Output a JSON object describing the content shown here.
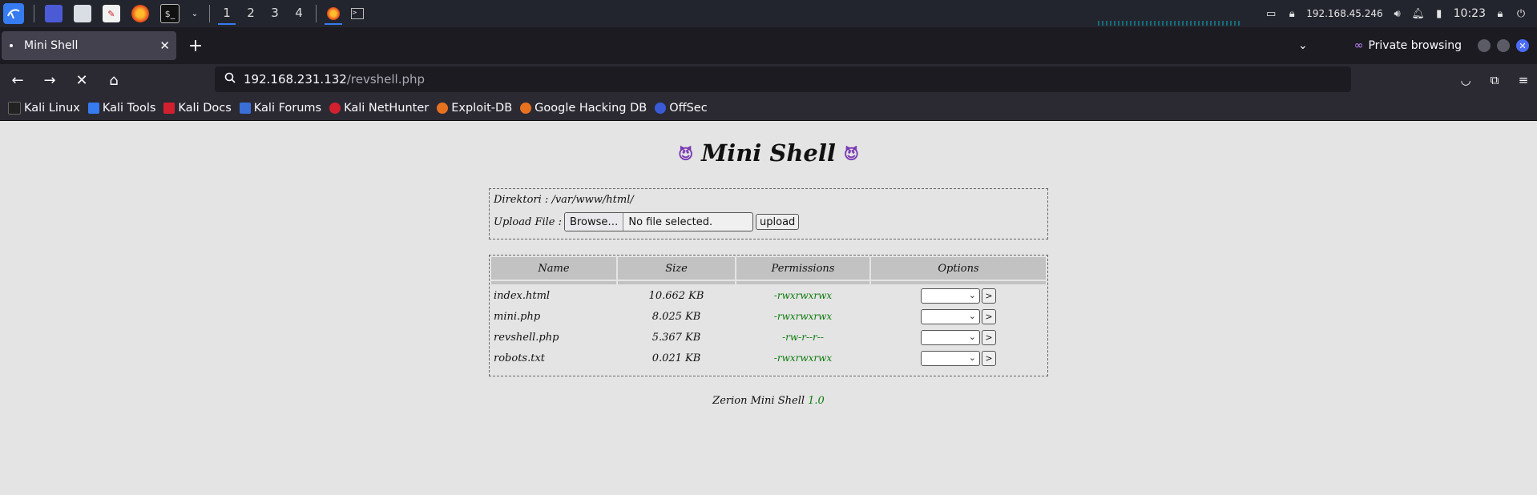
{
  "taskbar": {
    "workspaces": [
      "1",
      "2",
      "3",
      "4"
    ],
    "ip": "192.168.45.246",
    "clock": "10:23"
  },
  "browser": {
    "tab_title": "Mini Shell",
    "private_label": "Private browsing",
    "url_host": "192.168.231.132",
    "url_path": "/revshell.php",
    "bookmarks": [
      "Kali Linux",
      "Kali Tools",
      "Kali Docs",
      "Kali Forums",
      "Kali NetHunter",
      "Exploit-DB",
      "Google Hacking DB",
      "OffSec"
    ]
  },
  "page": {
    "title": "Mini Shell",
    "directory_label": "Direktori : ",
    "directory_value": "/var/www/html/",
    "upload_label": "Upload File : ",
    "browse_label": "Browse…",
    "no_file_label": "No file selected.",
    "upload_button": "upload",
    "columns": [
      "Name",
      "Size",
      "Permissions",
      "Options"
    ],
    "files": [
      {
        "name": "index.html",
        "size": "10.662 KB",
        "perms": "-rwxrwxrwx"
      },
      {
        "name": "mini.php",
        "size": "8.025 KB",
        "perms": "-rwxrwxrwx"
      },
      {
        "name": "revshell.php",
        "size": "5.367 KB",
        "perms": "-rw-r--r--"
      },
      {
        "name": "robots.txt",
        "size": "0.021 KB",
        "perms": "-rwxrwxrwx"
      }
    ],
    "go_label": ">",
    "footer_text": "Zerion Mini Shell ",
    "footer_version": "1.0"
  },
  "colors": {
    "kali_blue": "#367bf0",
    "permission_green": "#0b7a0b",
    "table_header_gray": "#c2c2c2"
  }
}
